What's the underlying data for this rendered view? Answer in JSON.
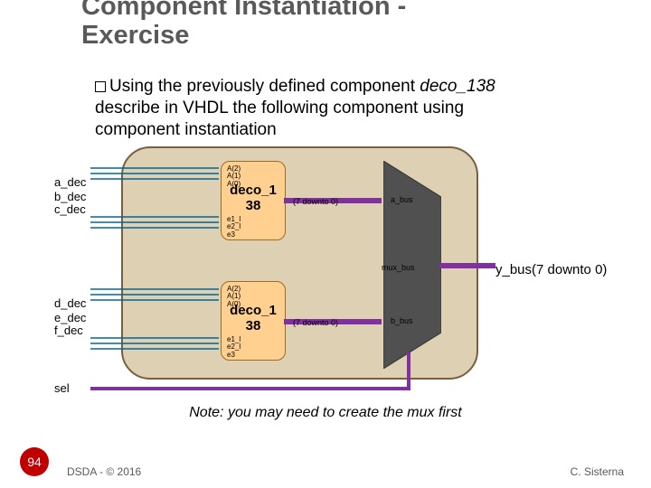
{
  "title_line1": "Component Instantiation -",
  "title_line2": "Exercise",
  "body": {
    "prefix": "Using the previously defined component ",
    "comp_name": "deco_138",
    "rest1": "describe in VHDL the following component using",
    "rest2": "component instantiation"
  },
  "inputs_top": [
    "a_dec",
    "b_dec",
    "c_dec"
  ],
  "inputs_bot": [
    "d_dec",
    "e_dec",
    "f_dec"
  ],
  "sel_label": "sel",
  "decoder": {
    "name_l1": "deco_1",
    "name_l2": "38",
    "pins_top": [
      "A(2)",
      "A(1)",
      "A(0)"
    ],
    "pins_bot": [
      "e1_l",
      "e2_l",
      "e3"
    ]
  },
  "bus_range": "(7 downto 0)",
  "a_bus": "a_bus",
  "b_bus": "b_bus",
  "mux_bus": "mux_bus",
  "output": "y_bus(7 downto 0)",
  "note": "Note: you may need to create the mux first",
  "page": "94",
  "footer_left": "DSDA - © 2016",
  "footer_right": "C. Sisterna"
}
